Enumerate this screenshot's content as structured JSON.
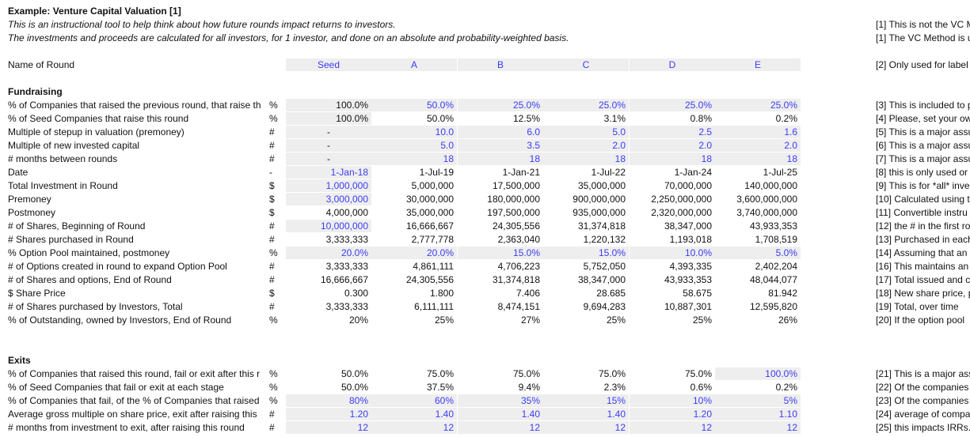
{
  "header": {
    "title": "Example: Venture Capital Valuation [1]",
    "subtitle1": "This is an instructional tool to help think about how future rounds impact returns to investors.",
    "subtitle2": "The investments and proceeds are calculated for all investors, for 1 investor, and done on an absolute and probability-weighted basis."
  },
  "top_notes": [
    "[1] This is not the VC M",
    "[1] The VC Method is u"
  ],
  "round_row": {
    "label": "Name of Round",
    "rounds": [
      "Seed",
      "A",
      "B",
      "C",
      "D",
      "E"
    ],
    "note": "[2] Only used for label"
  },
  "fundraising": {
    "title": "Fundraising",
    "rows": [
      {
        "label": "% of Companies that raised the previous round, that raise th",
        "unit": "%",
        "values": [
          "100.0%",
          "50.0%",
          "25.0%",
          "25.0%",
          "25.0%",
          "25.0%"
        ],
        "note": "[3] This is included to p"
      },
      {
        "label": "% of Seed Companies that raise this round",
        "unit": "%",
        "values": [
          "100.0%",
          "50.0%",
          "12.5%",
          "3.1%",
          "0.8%",
          "0.2%"
        ],
        "note": "[4] Please, set your ow"
      },
      {
        "label": "Multiple of stepup in valuation (premoney)",
        "unit": "#",
        "values": [
          "-",
          "10.0",
          "6.0",
          "5.0",
          "2.5",
          "1.6"
        ],
        "note": "[5] This is a major assu"
      },
      {
        "label": "Multiple of new invested capital",
        "unit": "#",
        "values": [
          "-",
          "5.0",
          "3.5",
          "2.0",
          "2.0",
          "2.0"
        ],
        "note": "[6] This is a major assu"
      },
      {
        "label": "# months between rounds",
        "unit": "#",
        "values": [
          "-",
          "18",
          "18",
          "18",
          "18",
          "18"
        ],
        "note": "[7] This is a major assu"
      },
      {
        "label": "Date",
        "unit": "-",
        "values": [
          "1-Jan-18",
          "1-Jul-19",
          "1-Jan-21",
          "1-Jul-22",
          "1-Jan-24",
          "1-Jul-25"
        ],
        "note": "[8] this is only used or"
      },
      {
        "label": "Total Investment in Round",
        "unit": "$",
        "values": [
          "1,000,000",
          "5,000,000",
          "17,500,000",
          "35,000,000",
          "70,000,000",
          "140,000,000"
        ],
        "note": "[9] This is for *all* inve"
      },
      {
        "label": "Premoney",
        "unit": "$",
        "values": [
          "3,000,000",
          "30,000,000",
          "180,000,000",
          "900,000,000",
          "2,250,000,000",
          "3,600,000,000"
        ],
        "note": "[10] Calculated using t"
      },
      {
        "label": "Postmoney",
        "unit": "$",
        "values": [
          "4,000,000",
          "35,000,000",
          "197,500,000",
          "935,000,000",
          "2,320,000,000",
          "3,740,000,000"
        ],
        "note": "[11] Convertible instru"
      },
      {
        "label": "# of Shares, Beginning of Round",
        "unit": "#",
        "values": [
          "10,000,000",
          "16,666,667",
          "24,305,556",
          "31,374,818",
          "38,347,000",
          "43,933,353"
        ],
        "note": "[12] the # in the first ro"
      },
      {
        "label": "# Shares purchased in Round",
        "unit": "#",
        "values": [
          "3,333,333",
          "2,777,778",
          "2,363,040",
          "1,220,132",
          "1,193,018",
          "1,708,519"
        ],
        "note": "[13] Purchased in each"
      },
      {
        "label": "% Option Pool maintained, postmoney",
        "unit": "%",
        "values": [
          "20.0%",
          "20.0%",
          "15.0%",
          "15.0%",
          "10.0%",
          "5.0%"
        ],
        "note": "[14] Assuming that an"
      },
      {
        "label": "# of Options created in round to expand Option Pool",
        "unit": "#",
        "values": [
          "3,333,333",
          "4,861,111",
          "4,706,223",
          "5,752,050",
          "4,393,335",
          "2,402,204"
        ],
        "note": "[16] This maintains an"
      },
      {
        "label": "# of Shares and options, End of Round",
        "unit": "#",
        "values": [
          "16,666,667",
          "24,305,556",
          "31,374,818",
          "38,347,000",
          "43,933,353",
          "48,044,077"
        ],
        "note": "[17] Total issued and c"
      },
      {
        "label": "$ Share Price",
        "unit": "$",
        "values": [
          "0.300",
          "1.800",
          "7.406",
          "28.685",
          "58.675",
          "81.942"
        ],
        "note": "[18] New share price, p"
      },
      {
        "label": "# of Shares purchased by Investors, Total",
        "unit": "#",
        "values": [
          "3,333,333",
          "6,111,111",
          "8,474,151",
          "9,694,283",
          "10,887,301",
          "12,595,820"
        ],
        "note": "[19] Total, over time"
      },
      {
        "label": "% of Outstanding, owned by Investors, End of Round",
        "unit": "%",
        "values": [
          "20%",
          "25%",
          "27%",
          "25%",
          "25%",
          "26%"
        ],
        "note": "[20] If the option pool"
      }
    ]
  },
  "exits": {
    "title": "Exits",
    "rows": [
      {
        "label": "% of Companies that raised this round, fail or exit after this r",
        "unit": "%",
        "values": [
          "50.0%",
          "75.0%",
          "75.0%",
          "75.0%",
          "75.0%",
          "100.0%"
        ],
        "note": "[21] This is a major ass"
      },
      {
        "label": "% of Seed Companies that fail or exit at each stage",
        "unit": "%",
        "values": [
          "50.0%",
          "37.5%",
          "9.4%",
          "2.3%",
          "0.6%",
          "0.2%"
        ],
        "note": "[22] Of the companies"
      },
      {
        "label": "% of Companies that fail, of the % of Companies that raised",
        "unit": "%",
        "values": [
          "80%",
          "60%",
          "35%",
          "15%",
          "10%",
          "5%"
        ],
        "note": "[23] Of the companies"
      },
      {
        "label": "Average gross multiple on share price, exit after raising this",
        "unit": "#",
        "values": [
          "1.20",
          "1.40",
          "1.40",
          "1.40",
          "1.20",
          "1.10"
        ],
        "note": "[24] average of compa"
      },
      {
        "label": "# months from investment to exit, after raising this round",
        "unit": "#",
        "values": [
          "12",
          "12",
          "12",
          "12",
          "12",
          "12"
        ],
        "note": "[25] this impacts IRRs."
      }
    ]
  },
  "colors": {
    "input_blue": "#3c3cf0",
    "shade": "#eeeeef",
    "text": "#111111"
  }
}
